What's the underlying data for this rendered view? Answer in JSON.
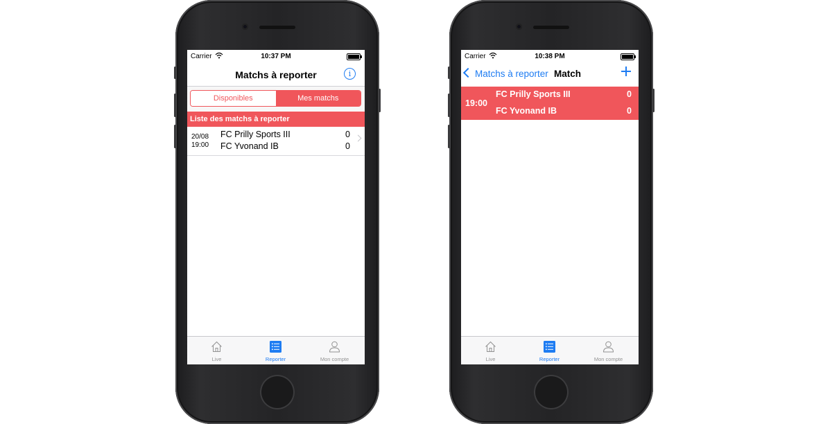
{
  "left_phone": {
    "status": {
      "carrier": "Carrier",
      "time": "10:37 PM"
    },
    "nav_title": "Matchs à reporter",
    "segments": [
      "Disponibles",
      "Mes matchs"
    ],
    "section_header": "Liste des matchs à reporter",
    "match": {
      "date": "20/08",
      "time": "19:00",
      "home_team": "FC Prilly Sports III",
      "home_score": "0",
      "away_team": "FC Yvonand IB",
      "away_score": "0"
    }
  },
  "right_phone": {
    "status": {
      "carrier": "Carrier",
      "time": "10:38 PM"
    },
    "back_label": "Matchs à reporter",
    "nav_title": "Match",
    "match": {
      "time": "19:00",
      "home_team": "FC Prilly Sports III",
      "home_score": "0",
      "away_team": "FC Yvonand IB",
      "away_score": "0"
    }
  },
  "tabbar": {
    "tabs": [
      {
        "label": "Live",
        "icon": "house-icon"
      },
      {
        "label": "Reporter",
        "icon": "list-icon"
      },
      {
        "label": "Mon compte",
        "icon": "person-icon"
      }
    ],
    "active": "Reporter"
  },
  "colors": {
    "accent_red": "#f0565b",
    "ios_blue": "#1e7cf2",
    "inactive_gray": "#929292"
  }
}
